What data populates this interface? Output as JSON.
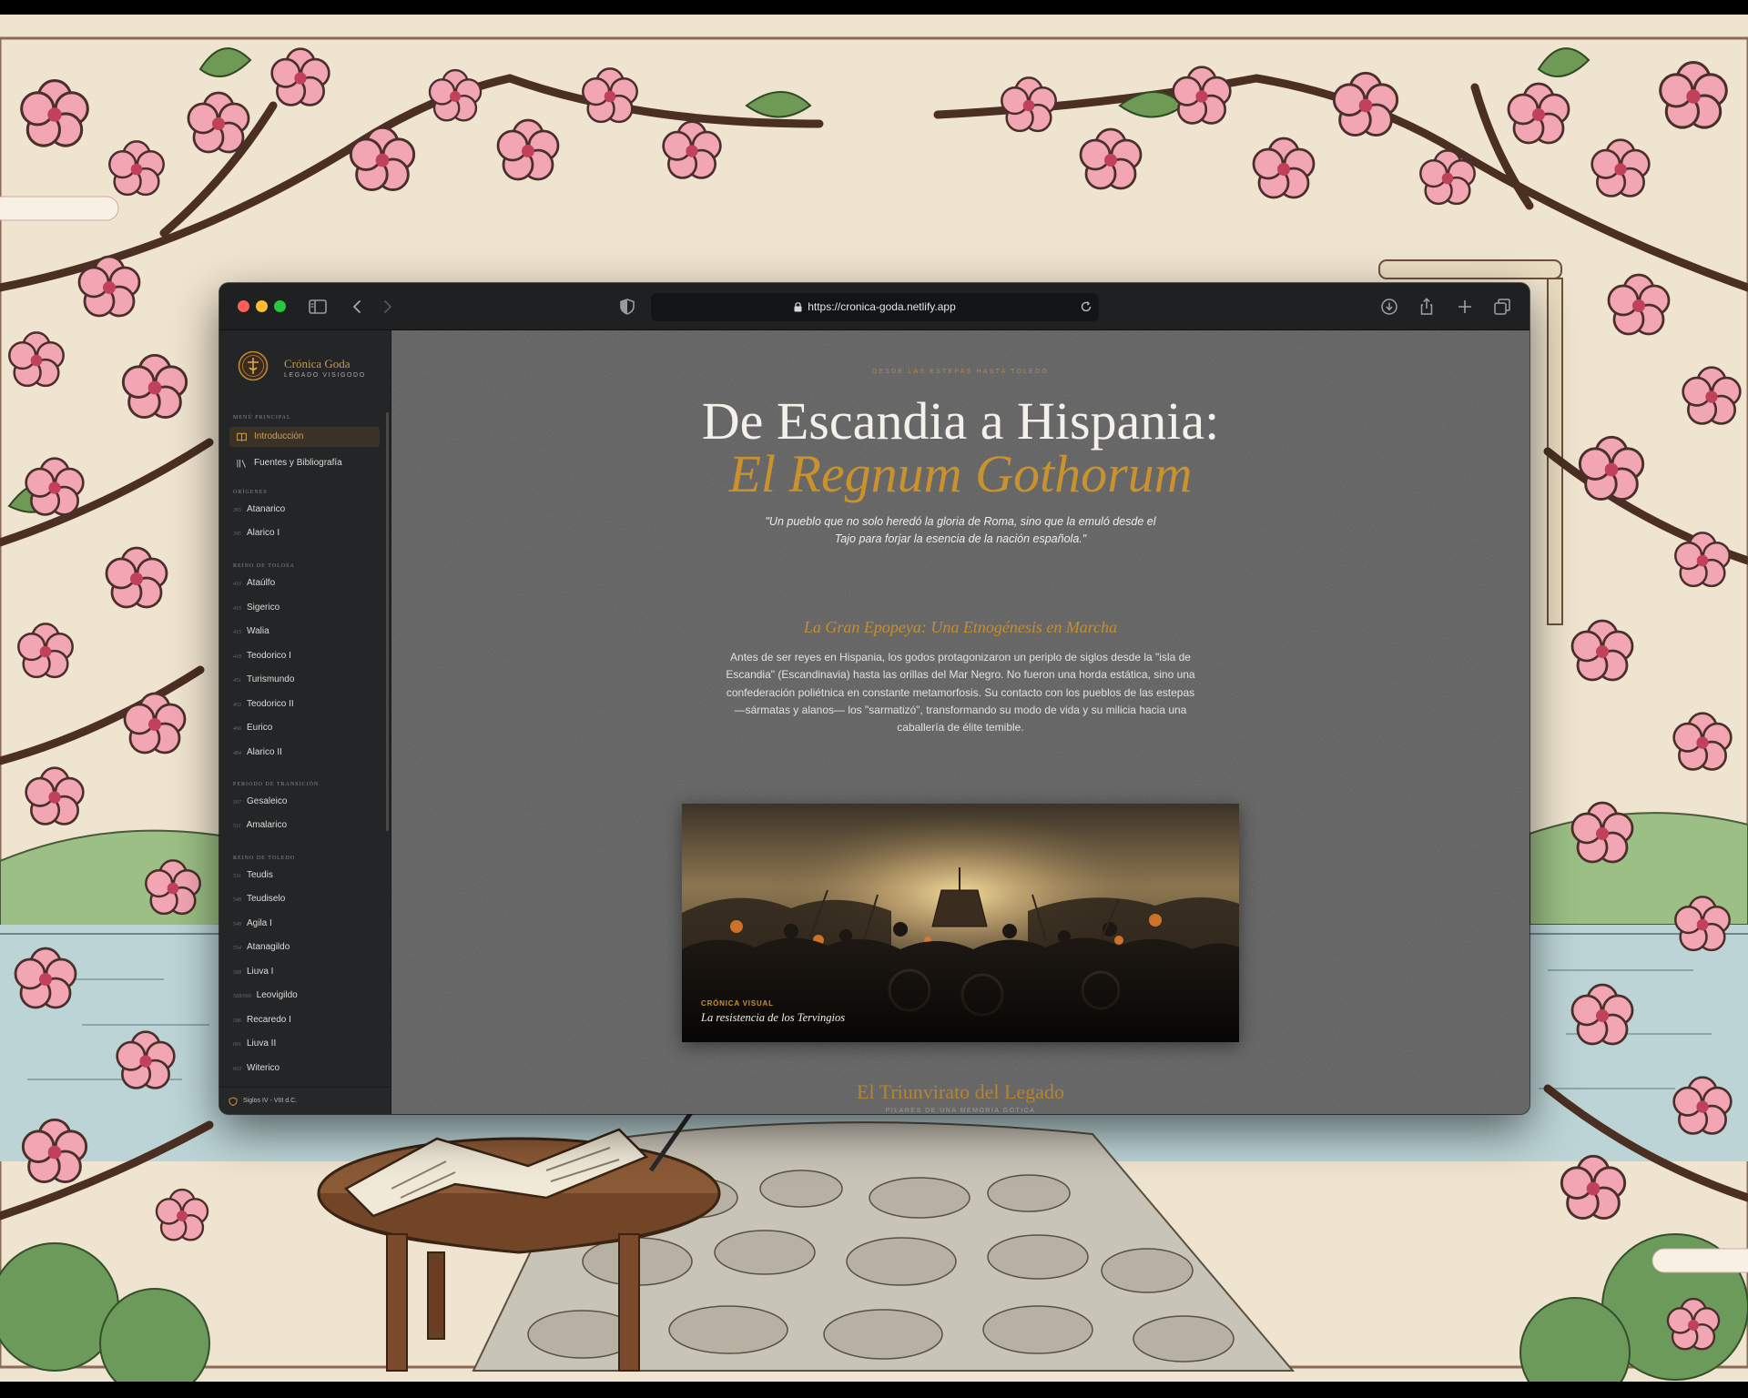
{
  "browser": {
    "url": "https://cronica-goda.netlify.app"
  },
  "sidebar": {
    "brand_name": "Crónica Goda",
    "brand_subtitle": "LEGADO VISIGODO",
    "sections": {
      "main": "MENÚ PRINCIPAL",
      "origins": "ORÍGENES",
      "tolosa": "REINO DE TOLOSA",
      "transition": "PERIODO DE TRANSICIÓN",
      "toledo": "REINO DE TOLEDO"
    },
    "main_items": [
      {
        "label": "Introducción",
        "active": true
      },
      {
        "label": "Fuentes y Bibliografía",
        "active": false
      }
    ],
    "origins": [
      {
        "year": "365",
        "name": "Atanarico"
      },
      {
        "year": "395",
        "name": "Alarico I"
      }
    ],
    "tolosa": [
      {
        "year": "410",
        "name": "Ataúlfo"
      },
      {
        "year": "415",
        "name": "Sigerico"
      },
      {
        "year": "415",
        "name": "Walia"
      },
      {
        "year": "418",
        "name": "Teodorico I"
      },
      {
        "year": "451",
        "name": "Turismundo"
      },
      {
        "year": "453",
        "name": "Teodorico II"
      },
      {
        "year": "466",
        "name": "Eurico"
      },
      {
        "year": "484",
        "name": "Alarico II"
      }
    ],
    "transition": [
      {
        "year": "507",
        "name": "Gesaleico"
      },
      {
        "year": "511",
        "name": "Amalarico"
      }
    ],
    "toledo": [
      {
        "year": "531",
        "name": "Teudis"
      },
      {
        "year": "548",
        "name": "Teudiselo"
      },
      {
        "year": "549",
        "name": "Agila I"
      },
      {
        "year": "554",
        "name": "Atanagildo"
      },
      {
        "year": "568",
        "name": "Liuva I"
      },
      {
        "year": "568/569",
        "name": "Leovigildo"
      },
      {
        "year": "586",
        "name": "Recaredo I"
      },
      {
        "year": "601",
        "name": "Liuva II"
      },
      {
        "year": "603",
        "name": "Witerico"
      }
    ],
    "footer": "Siglos IV - VIII d.C."
  },
  "main": {
    "kicker": "DESDE LAS ESTEPAS HASTA TOLEDO",
    "title_line1": "De Escandia a Hispania:",
    "title_line2": "El Regnum Gothorum",
    "quote": "\"Un pueblo que no solo heredó la gloria de Roma, sino que la emuló desde el Tajo para forjar la esencia de la nación española.\"",
    "section_title": "La Gran Epopeya: Una Etnogénesis en Marcha",
    "section_body": "Antes de ser reyes en Hispania, los godos protagonizaron un periplo de siglos desde la \"isla de Escandia\" (Escandinavia) hasta las orillas del Mar Negro. No fueron una horda estática, sino una confederación poliétnica en constante metamorfosis. Su contacto con los pueblos de las estepas —sármatas y alanos— los \"sarmatizó\", transformando su modo de vida y su milicia hacia una caballería de élite temible.",
    "figure_kicker": "CRÓNICA VISUAL",
    "figure_caption": "La resistencia de los Tervingios",
    "next_title": "El Triunvirato del Legado",
    "next_subtitle": "PILARES DE UNA MEMORIA GÓTICA"
  },
  "colors": {
    "accent_gold": "#c9922d",
    "main_bg": "#5f5f5f",
    "sidebar_bg": "#242526"
  }
}
